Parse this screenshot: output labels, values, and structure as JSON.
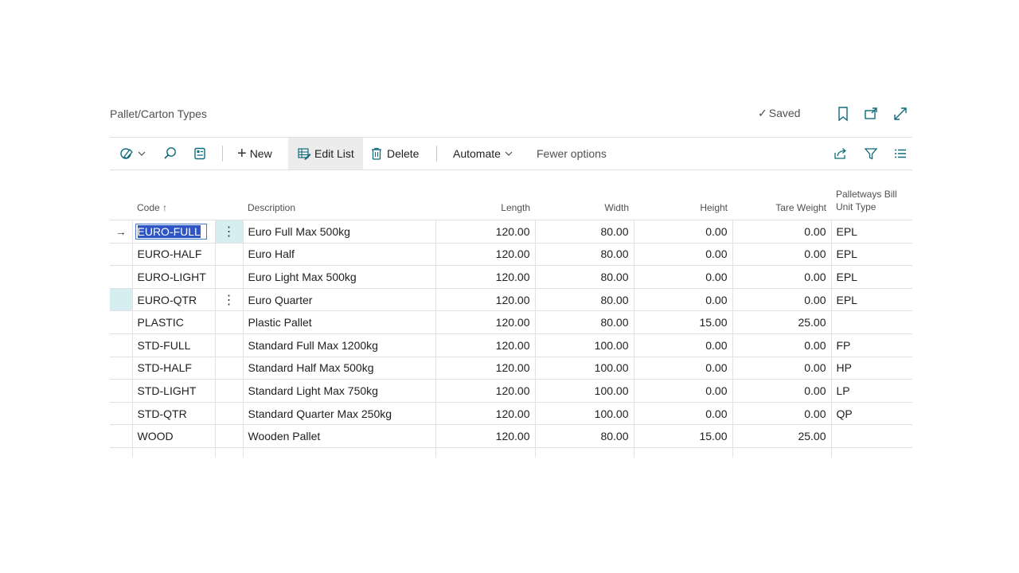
{
  "page": {
    "title": "Pallet/Carton Types"
  },
  "header": {
    "saved_label": "Saved",
    "saved_check": "✓"
  },
  "actions": {
    "new_plus": "+",
    "new_label": "New",
    "edit_list_label": "Edit List",
    "delete_label": "Delete",
    "automate_label": "Automate",
    "fewer_options_label": "Fewer options"
  },
  "columns": {
    "code": "Code",
    "code_sort": "↑",
    "description": "Description",
    "length": "Length",
    "width": "Width",
    "height": "Height",
    "tare_weight": "Tare Weight",
    "palletways_line1": "Palletways Bill",
    "palletways_line2": "Unit Type"
  },
  "rows": [
    {
      "code": "EURO-FULL",
      "description": "Euro Full Max 500kg",
      "length": "120.00",
      "width": "80.00",
      "height": "0.00",
      "tare": "0.00",
      "unit": "EPL"
    },
    {
      "code": "EURO-HALF",
      "description": "Euro Half",
      "length": "120.00",
      "width": "80.00",
      "height": "0.00",
      "tare": "0.00",
      "unit": "EPL"
    },
    {
      "code": "EURO-LIGHT",
      "description": "Euro Light Max 500kg",
      "length": "120.00",
      "width": "80.00",
      "height": "0.00",
      "tare": "0.00",
      "unit": "EPL"
    },
    {
      "code": "EURO-QTR",
      "description": "Euro Quarter",
      "length": "120.00",
      "width": "80.00",
      "height": "0.00",
      "tare": "0.00",
      "unit": "EPL"
    },
    {
      "code": "PLASTIC",
      "description": "Plastic Pallet",
      "length": "120.00",
      "width": "80.00",
      "height": "15.00",
      "tare": "25.00",
      "unit": ""
    },
    {
      "code": "STD-FULL",
      "description": "Standard Full Max 1200kg",
      "length": "120.00",
      "width": "100.00",
      "height": "0.00",
      "tare": "0.00",
      "unit": "FP"
    },
    {
      "code": "STD-HALF",
      "description": "Standard Half Max 500kg",
      "length": "120.00",
      "width": "100.00",
      "height": "0.00",
      "tare": "0.00",
      "unit": "HP"
    },
    {
      "code": "STD-LIGHT",
      "description": "Standard Light Max 750kg",
      "length": "120.00",
      "width": "100.00",
      "height": "0.00",
      "tare": "0.00",
      "unit": "LP"
    },
    {
      "code": "STD-QTR",
      "description": "Standard Quarter Max 250kg",
      "length": "120.00",
      "width": "100.00",
      "height": "0.00",
      "tare": "0.00",
      "unit": "QP"
    },
    {
      "code": "WOOD",
      "description": "Wooden Pallet",
      "length": "120.00",
      "width": "80.00",
      "height": "15.00",
      "tare": "25.00",
      "unit": ""
    }
  ],
  "glyphs": {
    "current_row_arrow": "→",
    "row_menu": "⋮"
  },
  "colors": {
    "accent": "#2f55c4",
    "selection": "#d6eef1",
    "icon": "#0f6b7a"
  }
}
